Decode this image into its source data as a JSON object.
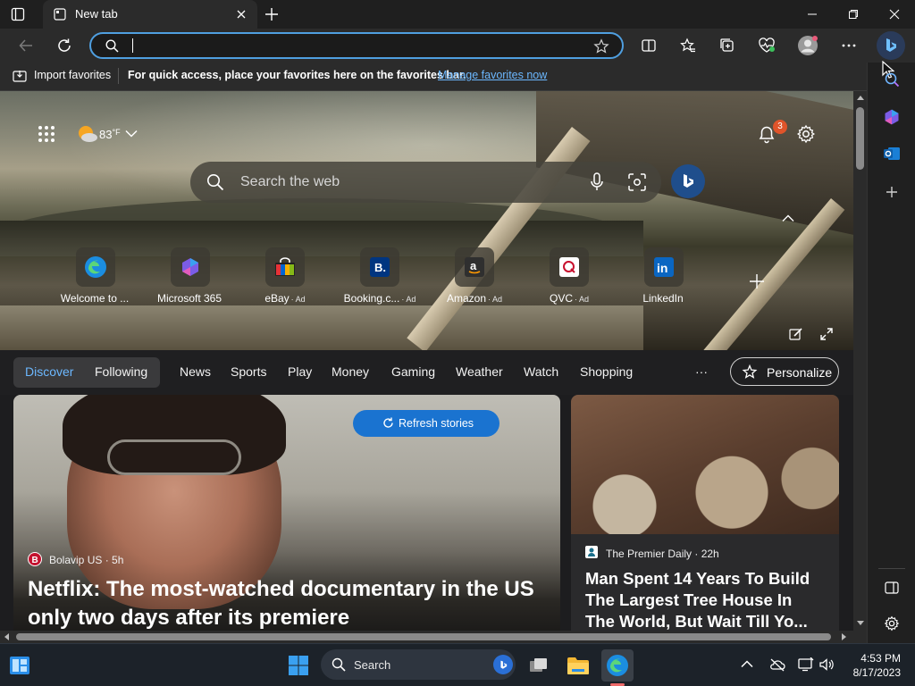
{
  "titlebar": {
    "tab_title": "New tab"
  },
  "toolbar": {
    "address_value": ""
  },
  "favbar": {
    "import_label": "Import favorites",
    "message": "For quick access, place your favorites here on the favorites bar.",
    "manage_link": "Manage favorites now"
  },
  "weather": {
    "temp": "83",
    "unit": "°F"
  },
  "notifications": {
    "count": "3"
  },
  "hero_search": {
    "placeholder": "Search the web"
  },
  "quick_links": [
    {
      "label": "Welcome to ...",
      "ad": "",
      "icon": "edge-icon"
    },
    {
      "label": "Microsoft 365",
      "ad": "",
      "icon": "microsoft365-icon"
    },
    {
      "label": "eBay",
      "ad": "· Ad",
      "icon": "ebay-icon"
    },
    {
      "label": "Booking.c...",
      "ad": "· Ad",
      "icon": "booking-icon"
    },
    {
      "label": "Amazon",
      "ad": "· Ad",
      "icon": "amazon-icon"
    },
    {
      "label": "QVC",
      "ad": "· Ad",
      "icon": "qvc-icon"
    },
    {
      "label": "LinkedIn",
      "ad": "",
      "icon": "linkedin-icon"
    }
  ],
  "nav": {
    "discover": "Discover",
    "following": "Following",
    "items": [
      "News",
      "Sports",
      "Play",
      "Money",
      "Gaming",
      "Weather",
      "Watch",
      "Shopping"
    ],
    "more": "···",
    "personalize": "Personalize"
  },
  "card1": {
    "refresh": "Refresh stories",
    "source": "Bolavip US · 5h",
    "title_line1": "Netflix: The most-watched documentary in the US",
    "title_line2": "only two days after its premiere"
  },
  "card2": {
    "source": "The Premier Daily · 22h",
    "title_line1": "Man Spent 14 Years To Build",
    "title_line2": "The Largest Tree House In",
    "title_line3": "The World, But Wait Till Yo..."
  },
  "taskbar": {
    "search_label": "Search",
    "time": "4:53 PM",
    "date": "8/17/2023"
  },
  "colors": {
    "accent": "#4f9fe0",
    "link": "#6cb8ff",
    "refresh_button": "#1a73d0",
    "badge": "#e0542a"
  }
}
